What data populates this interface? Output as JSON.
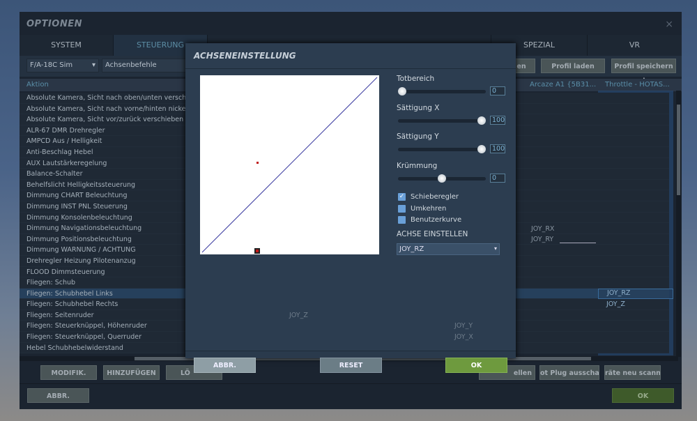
{
  "window": {
    "title": "OPTIONEN",
    "close": "×"
  },
  "tabs": [
    "SYSTEM",
    "STEUERUNG",
    "SPEZIAL",
    "VR"
  ],
  "toolbar": {
    "aircraft": "F/A-18C Sim",
    "category": "Achsenbefehle",
    "btn_partial": "en",
    "load_profile": "Profil laden",
    "save_profile_as": "Profil speichern als"
  },
  "table": {
    "headers": {
      "action": "Aktion",
      "arcaze": "Arcaze A1 {5B31...",
      "throttle": "Throttle - HOTAS..."
    },
    "rows": [
      "Absolute Kamera, Sicht nach oben/unten verschieben",
      "Absolute Kamera, Sicht nach vorne/hinten nicken",
      "Absolute Kamera, Sicht vor/zurück verschieben",
      "ALR-67 DMR Drehregler",
      "AMPCD Aus / Helligkeit",
      "Anti-Beschlag Hebel",
      "AUX Lautstärkeregelung",
      "Balance-Schalter",
      "Behelfslicht Helligkeitssteuerung",
      "Dimmung CHART Beleuchtung",
      "Dimmung INST PNL Steuerung",
      "Dimmung Konsolenbeleuchtung",
      "Dimmung Navigationsbeleuchtung",
      "Dimmung Positionsbeleuchtung",
      "Dimmung WARNUNG / ACHTUNG",
      "Drehregler Heizung Pilotenanzug",
      "FLOOD Dimmsteuerung",
      "Fliegen: Schub",
      "Fliegen: Schubhebel Links",
      "Fliegen: Schubhebel Rechts",
      "Fliegen: Seitenruder",
      "Fliegen: Steuerknüppel, Höhenruder",
      "Fliegen: Steuerknüppel, Querruder",
      "Hebel Schubhebelwiderstand"
    ],
    "cells": {
      "nav_arcaze": "JOY_RX",
      "pos_arcaze": "JOY_RY",
      "schub_links_throttle": "JOY_RZ",
      "schub_rechts_throttle": "JOY_Z",
      "seitenruder": "JOY_Z",
      "hoehenruder": "JOY_Y",
      "querruder": "JOY_X"
    }
  },
  "bottom_buttons": [
    "MODIFIK.",
    "HINZUFÜGEN",
    "LÖ",
    "ellen",
    "ot Plug ausschalte",
    "räte neu scanne"
  ],
  "footer": {
    "cancel": "ABBR.",
    "ok": "OK"
  },
  "dialog": {
    "title": "ACHSENEINSTELLUNG",
    "sliders": [
      {
        "label": "Totbereich",
        "value": "0",
        "pos": 0
      },
      {
        "label": "Sättigung X",
        "value": "100",
        "pos": 1
      },
      {
        "label": "Sättigung Y",
        "value": "100",
        "pos": 1
      },
      {
        "label": "Krümmung",
        "value": "0",
        "pos": 0.5
      }
    ],
    "checkboxes": [
      {
        "label": "Schieberegler",
        "checked": true
      },
      {
        "label": "Umkehren",
        "checked": false
      },
      {
        "label": "Benutzerkurve",
        "checked": false
      }
    ],
    "axis_label": "ACHSE EINSTELLEN",
    "axis_value": "JOY_RZ",
    "cancel": "ABBR.",
    "reset": "RESET",
    "ok": "OK"
  },
  "colors": {
    "ok_green": "#6e9a3e",
    "curve": "#3a3aa0",
    "marker": "#c01818"
  }
}
